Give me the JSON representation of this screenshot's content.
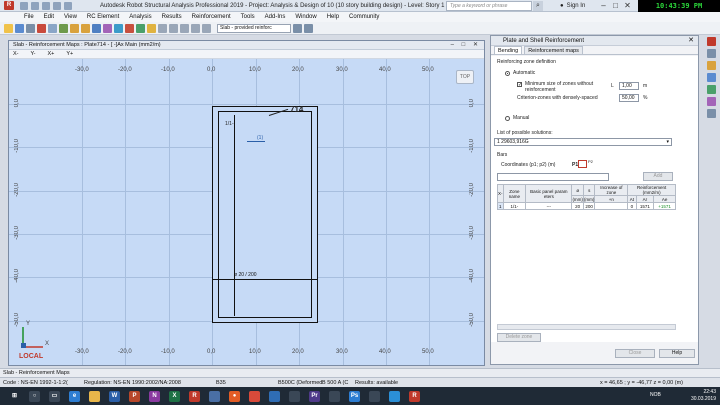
{
  "window": {
    "title": "Autodesk Robot Structural Analysis Professional 2019 - Project: Analysis & Design of 10 (10 story building design) - Level: Story 1 - Results: available",
    "search_placeholder": "Type a keyword or phrase",
    "sign_in": "Sign In",
    "clock": "10:43:39 PM 03/30/2019"
  },
  "menu": [
    "File",
    "Edit",
    "View",
    "RC Element",
    "Analysis",
    "Results",
    "Reinforcement",
    "Tools",
    "Add-Ins",
    "Window",
    "Help",
    "Community"
  ],
  "toolbar": {
    "combo": "Slab - provided reinforc"
  },
  "view": {
    "title": "Slab - Reinforcement Maps : Plate714 - [ -]Ax Main (mm2/m)",
    "axis_tabs": [
      "X-",
      "Y-",
      "X+",
      "Y+"
    ],
    "top_ruler": [
      "-30,0",
      "-20,0",
      "-10,0",
      "0,0",
      "10,0",
      "20,0",
      "30,0",
      "40,0",
      "50,0"
    ],
    "bottom_ruler": [
      "-30,0",
      "-20,0",
      "-10,0",
      "0,0",
      "10,0",
      "20,0",
      "30,0",
      "40,0",
      "50,0"
    ],
    "left_ruler": [
      "0,0",
      "-10,0",
      "-20,0",
      "-30,0",
      "-40,0",
      "-50,0"
    ],
    "right_ruler": [
      "0,0",
      "-10,0",
      "-20,0",
      "-30,0",
      "-40,0",
      "-50,0"
    ],
    "plate_number": "714",
    "zone_label": "1/1-",
    "arrow_label": "(1)",
    "rebar_label": "ø 20 / 200",
    "top_button": "TOP",
    "axis_x": "X",
    "axis_y": "Y",
    "local": "LOCAL"
  },
  "dialog": {
    "title": "Plate and Shell Reinforcement",
    "close": "✕",
    "tabs": [
      "Bending",
      "Reinforcement maps"
    ],
    "zone_def": "Reinforcing zone definition",
    "automatic": "Automatic",
    "min_size_label": "Minimum size of zones without reinforcement",
    "criterion_label": "Criterion-zones with densely-spaced",
    "l_label": "L",
    "l_value": "1,00",
    "l_unit": "m",
    "crit_value": "50,00",
    "crit_unit": "%",
    "manual": "Manual",
    "solutions_label": "List of possible solutions:",
    "solution_value": "1   29603,916G",
    "bars_label": "Bars",
    "coord_label": "Coordinates (p1; p2) (m)",
    "p1_label": "P1",
    "p2_label": "P2",
    "add_button": "Add",
    "table": {
      "headers": [
        "X-",
        "Zone name",
        "Basic panel param eters",
        "ø",
        "s",
        "Increase of zone",
        "Reinforcement (mm2/m)"
      ],
      "sub_headers": [
        "(mm)",
        "(mm)",
        "+n",
        "At",
        "Ar",
        "Ae"
      ],
      "row": [
        "1",
        "1/1-",
        "---",
        "20",
        "200",
        "",
        "0",
        "1571",
        "+1571"
      ]
    },
    "delete_button": "Delete zone",
    "close_button": "Close",
    "help_button": "Help"
  },
  "status": {
    "line1": "Slab - Reinforcement Maps",
    "code": "Code : NS-EN 1992-1-1:2(",
    "regulation": "Regulation: NS-EN 1990:2002/NA:2008",
    "concrete": "B35",
    "steel": "B500C (Deformed",
    "steel2": "B 500 A (C",
    "results": "Results: available",
    "coords": "x = 46,65 ; y = -46,77 z = 0,00    (m)"
  },
  "taskbar": {
    "lang": "NOB",
    "time": "22:43",
    "date": "30.03.2019"
  }
}
